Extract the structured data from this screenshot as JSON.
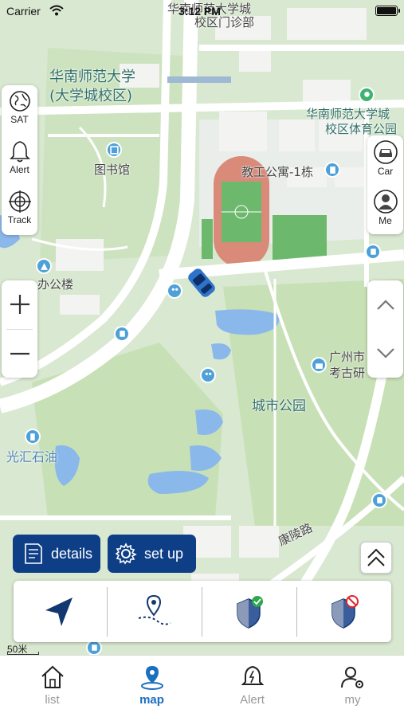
{
  "status_bar": {
    "carrier": "Carrier",
    "time": "3:12 PM"
  },
  "map": {
    "labels": {
      "south_china_normal": "华南师范大学",
      "university_town_campus": "(大学城校区)",
      "library": "图书馆",
      "sports_park_1": "华南师范大学城",
      "sports_park_2": "校区体育公园",
      "clinic_1": "华南师范大学城",
      "clinic_2": "校区门诊部",
      "staff_apartment": "教工公寓-1栋",
      "office_building": "办公楼",
      "guangzhou_city_1": "广州市",
      "guangzhou_city_2": "考古研",
      "city_park": "城市公园",
      "guanghui_oil": "光汇石油",
      "kangling_road": "康陵路"
    },
    "scale_label": "50米"
  },
  "left_tools": [
    {
      "label": "SAT",
      "icon": "satellite-globe-icon"
    },
    {
      "label": "Alert",
      "icon": "bell-icon"
    },
    {
      "label": "Track",
      "icon": "crosshair-icon"
    }
  ],
  "right_tools": [
    {
      "label": "Car",
      "icon": "car-icon"
    },
    {
      "label": "Me",
      "icon": "person-icon"
    }
  ],
  "zoom": {
    "in": "zoom-in-icon",
    "out": "zoom-out-icon"
  },
  "buttons": {
    "details": "details",
    "setup": "set up"
  },
  "action_strip": [
    "navigate-arrow-icon",
    "track-route-icon",
    "fence-on-icon",
    "fence-off-icon"
  ],
  "tabs": [
    {
      "label": "list",
      "icon": "home-icon",
      "active": false
    },
    {
      "label": "map",
      "icon": "map-pin-icon",
      "active": true
    },
    {
      "label": "Alert",
      "icon": "alert-bell-icon",
      "active": false
    },
    {
      "label": "my",
      "icon": "user-settings-icon",
      "active": false
    }
  ],
  "colors": {
    "brand": "#0e3e86",
    "active_tab": "#1a6fbf",
    "map_green": "#cfe3c4",
    "water": "#8ab8ea"
  }
}
